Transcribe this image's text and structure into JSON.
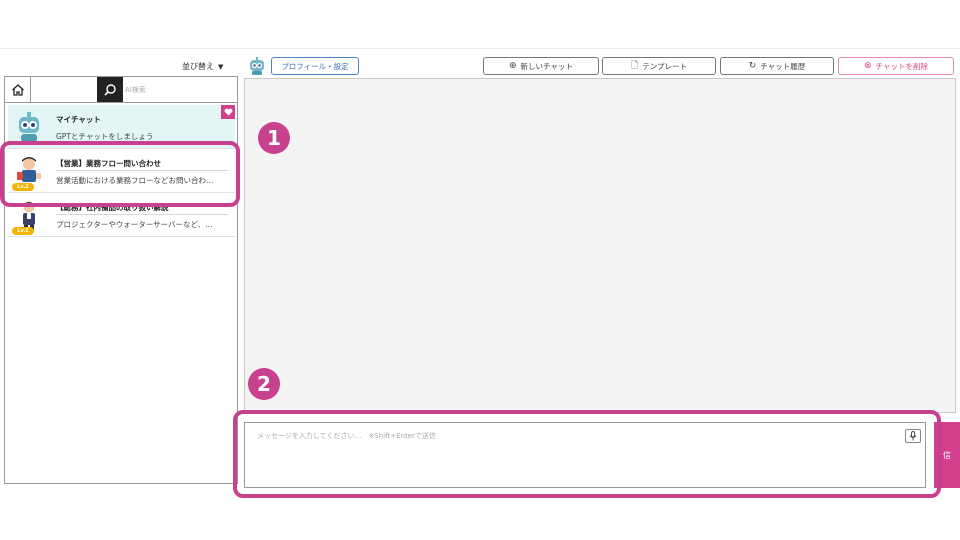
{
  "toolbar": {
    "sort_label": "並び替え",
    "profile_label": "プロフィール・設定",
    "new_chat_label": "新しいチャット",
    "template_label": "テンプレート",
    "history_label": "チャット履歴",
    "delete_label": "チャットを削除"
  },
  "search": {
    "placeholder": "AI検索"
  },
  "chats": [
    {
      "title": "マイチャット",
      "desc": "GPTとチャットをしましょう",
      "lv": "",
      "favorite": true
    },
    {
      "title": "【営業】業務フロー問い合わせ",
      "desc": "営業活動における業務フローなどお問い合わ…",
      "lv": "Lv.2"
    },
    {
      "title": "【総務】社内備品の取り扱い解説",
      "desc": "プロジェクターやウォーターサーバーなど、…",
      "lv": "Lv.2"
    }
  ],
  "input": {
    "placeholder": "メッセージを入力してください…　※Shift+Enterで送信"
  },
  "send_label": "信",
  "annotations": {
    "badge1": "1",
    "badge2": "2"
  },
  "colors": {
    "accent": "#d33f8a",
    "highlight": "#c8418f",
    "active_bg": "#e3f6f5"
  }
}
